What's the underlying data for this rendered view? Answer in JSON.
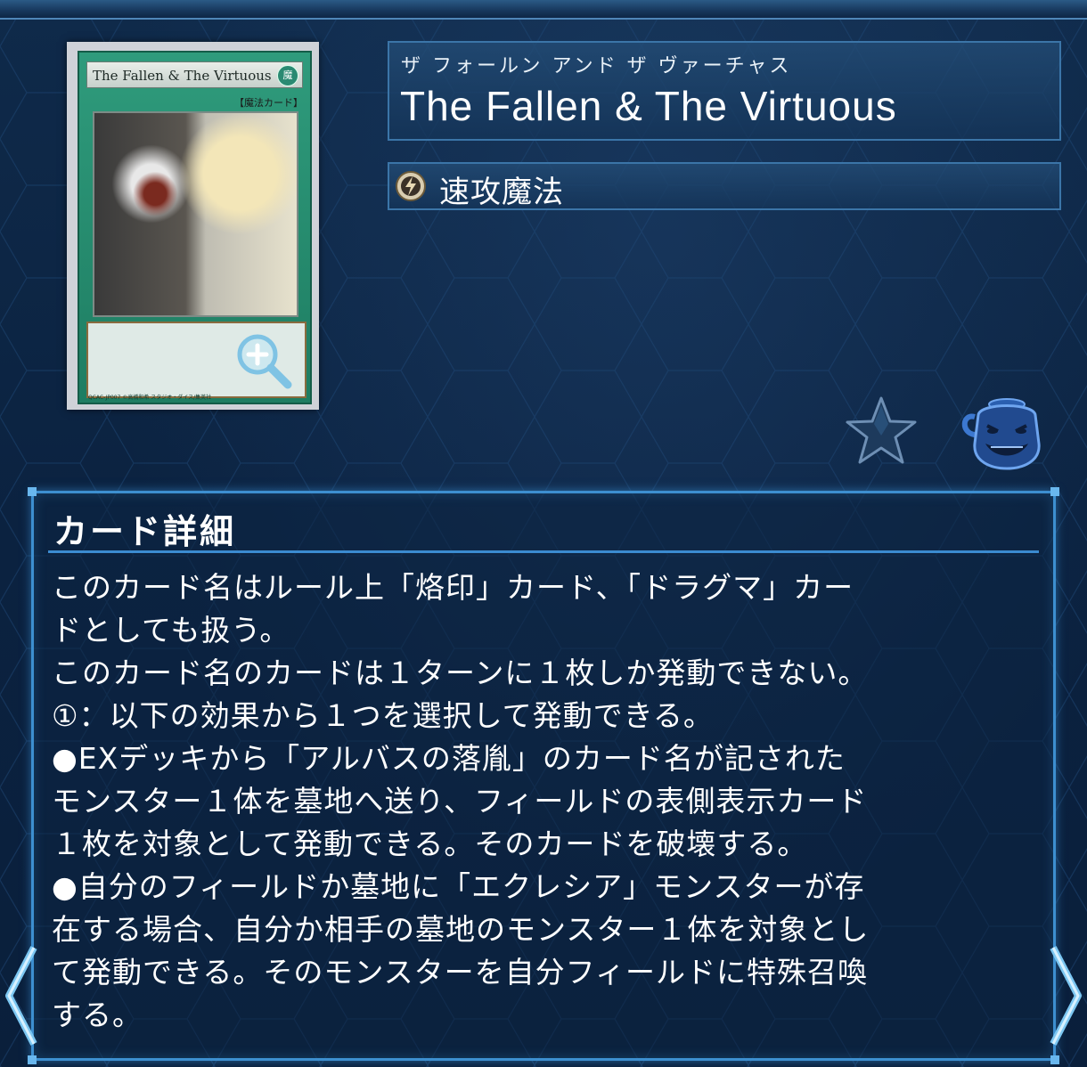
{
  "card": {
    "art_name": "The Fallen & The Virtuous",
    "art_type_line": "【魔法カード】",
    "art_footer": "QCAC-JP007 ©高橋和希 スタジオ・ダイス/集英社"
  },
  "title": {
    "ruby": "ザ フォールン アンド ザ ヴァーチャス",
    "name": "The Fallen & The Virtuous"
  },
  "type": {
    "icon": "quick-play-spell-icon",
    "label": "速攻魔法"
  },
  "actions": {
    "favorite_icon": "star-icon",
    "pot_icon": "pot-of-greed-icon"
  },
  "details": {
    "heading": "カード詳細",
    "lines": [
      "このカード名はルール上「烙印」カード、「ドラグマ」カー",
      "ドとしても扱う。",
      "このカード名のカードは１ターンに１枚しか発動できない。",
      "①：以下の効果から１つを選択して発動できる。",
      "●EXデッキから「アルバスの落胤」のカード名が記された",
      "モンスター１体を墓地へ送り、フィールドの表側表示カード",
      "１枚を対象として発動できる。そのカードを破壊する。",
      "●自分のフィールドか墓地に「エクレシア」モンスターが存",
      "在する場合、自分か相手の墓地のモンスター１体を対象とし",
      "て発動できる。そのモンスターを自分フィールドに特殊召喚",
      "する。"
    ]
  },
  "nav": {
    "prev_icon": "chevron-left-icon",
    "next_icon": "chevron-right-icon"
  },
  "colors": {
    "background": "#0c2340",
    "panel_border": "#3d8fd0",
    "spell_card": "#2f9b7c"
  }
}
